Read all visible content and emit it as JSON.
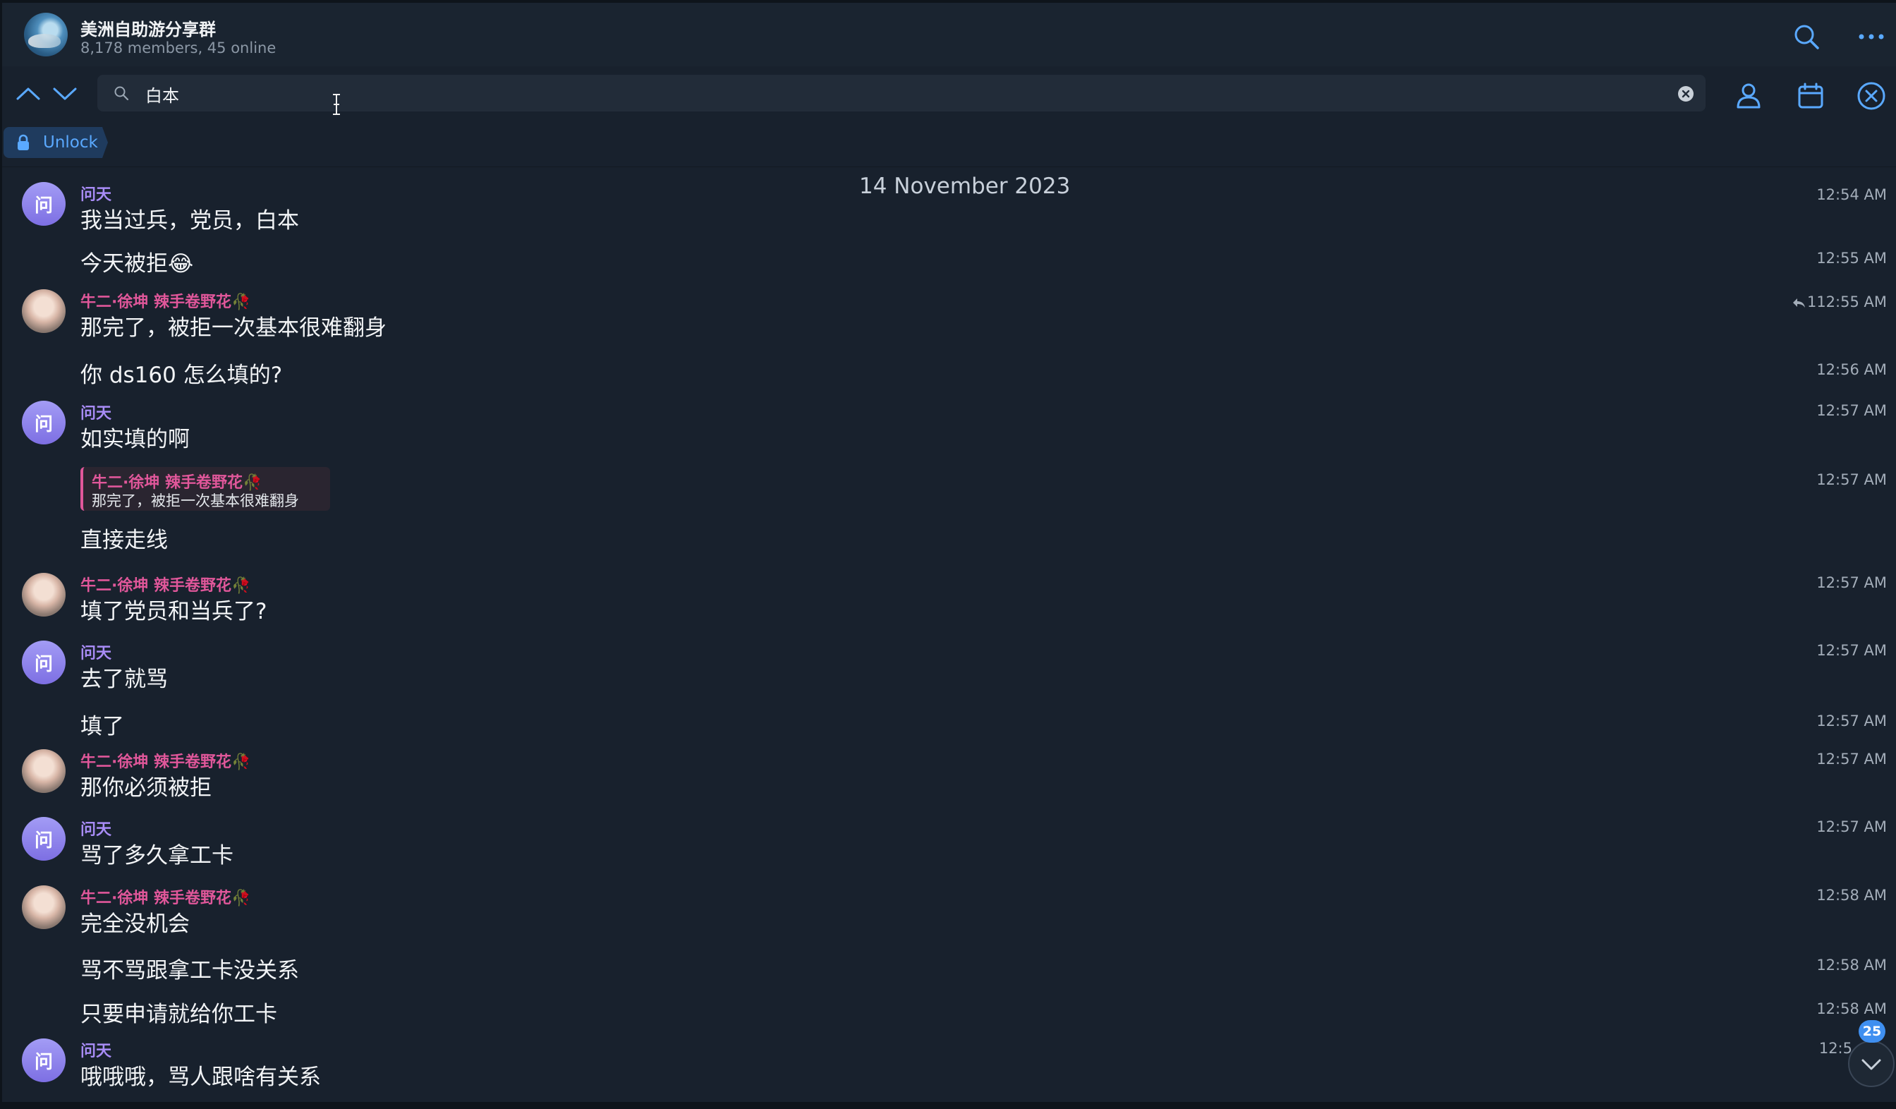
{
  "header": {
    "title": "美洲自助游分享群",
    "subtitle": "8,178 members, 45 online"
  },
  "search": {
    "value": "白本"
  },
  "unlock": {
    "label": "Unlock"
  },
  "date_header": "14 November 2023",
  "messages": [
    {
      "sender": "问天",
      "avatar_letter": "问",
      "text": "我当过兵，党员，白本",
      "time": "12:54 AM"
    },
    {
      "text": "今天被拒😂",
      "time": "12:55 AM"
    },
    {
      "sender": "牛二·徐坤 辣手卷野花🥀",
      "text": "那完了，被拒一次基本很难翻身",
      "time": "12:55 AM",
      "replies": "1"
    },
    {
      "text": "你 ds160 怎么填的?",
      "time": "12:56 AM"
    },
    {
      "sender": "问天",
      "avatar_letter": "问",
      "text": "如实填的啊",
      "time": "12:57 AM"
    },
    {
      "quote_sender": "牛二·徐坤 辣手卷野花🥀",
      "quote_text": "那完了，被拒一次基本很难翻身",
      "text": "直接走线",
      "time": "12:57 AM"
    },
    {
      "sender": "牛二·徐坤 辣手卷野花🥀",
      "text": "填了党员和当兵了?",
      "time": "12:57 AM"
    },
    {
      "sender": "问天",
      "avatar_letter": "问",
      "text": "去了就骂",
      "time": "12:57 AM"
    },
    {
      "text": "填了",
      "time": "12:57 AM"
    },
    {
      "sender": "牛二·徐坤 辣手卷野花🥀",
      "text": "那你必须被拒",
      "time": "12:57 AM"
    },
    {
      "sender": "问天",
      "avatar_letter": "问",
      "text": "骂了多久拿工卡",
      "time": "12:57 AM"
    },
    {
      "sender": "牛二·徐坤 辣手卷野花🥀",
      "text": "完全没机会",
      "time": "12:58 AM"
    },
    {
      "text": "骂不骂跟拿工卡没关系",
      "time": "12:58 AM"
    },
    {
      "text": "只要申请就给你工卡",
      "time": "12:58 AM"
    },
    {
      "sender": "问天",
      "avatar_letter": "问",
      "text": "哦哦哦，骂人跟啥有关系",
      "time": "12:5"
    }
  ],
  "unread_count": "25",
  "colors": {
    "background": "#18212d",
    "accent": "#3f8ff0",
    "sender_wen": "#a88cf6",
    "sender_niu": "#e0579a"
  }
}
